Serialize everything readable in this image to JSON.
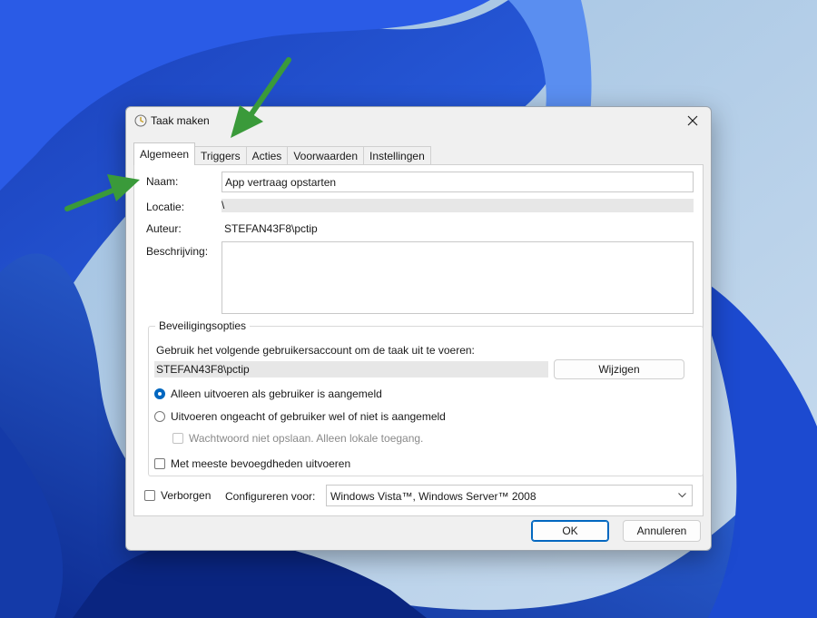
{
  "dialog": {
    "title": "Taak maken",
    "close_glyph": "✕",
    "icon": "clock-icon"
  },
  "tabs": [
    {
      "label": "Algemeen",
      "active": true
    },
    {
      "label": "Triggers",
      "active": false
    },
    {
      "label": "Acties",
      "active": false
    },
    {
      "label": "Voorwaarden",
      "active": false
    },
    {
      "label": "Instellingen",
      "active": false
    }
  ],
  "general": {
    "name_label": "Naam:",
    "name_value": "App vertraag opstarten",
    "location_label": "Locatie:",
    "location_value": "\\",
    "author_label": "Auteur:",
    "author_value": "STEFAN43F8\\pctip",
    "description_label": "Beschrijving:",
    "description_value": ""
  },
  "security": {
    "group_title": "Beveiligingsopties",
    "account_prompt": "Gebruik het volgende gebruikersaccount om de taak uit te voeren:",
    "account_value": "STEFAN43F8\\pctip",
    "change_button": "Wijzigen",
    "radio_logged_on": "Alleen uitvoeren als gebruiker is aangemeld",
    "radio_logged_on_selected": true,
    "radio_always": "Uitvoeren ongeacht of gebruiker wel of niet is aangemeld",
    "radio_always_selected": false,
    "no_store_password": "Wachtwoord niet opslaan. Alleen lokale toegang.",
    "no_store_password_checked": false,
    "highest_privileges": "Met meeste bevoegdheden uitvoeren",
    "highest_privileges_checked": false
  },
  "bottom": {
    "hidden_label": "Verborgen",
    "hidden_checked": false,
    "configure_label": "Configureren voor:",
    "configure_value": "Windows Vista™, Windows Server™ 2008"
  },
  "buttons": {
    "ok": "OK",
    "cancel": "Annuleren"
  },
  "colors": {
    "accent": "#0067c0",
    "annotation_arrow": "#3a9a3a",
    "wallpaper_blue": "#1f4fd6"
  }
}
